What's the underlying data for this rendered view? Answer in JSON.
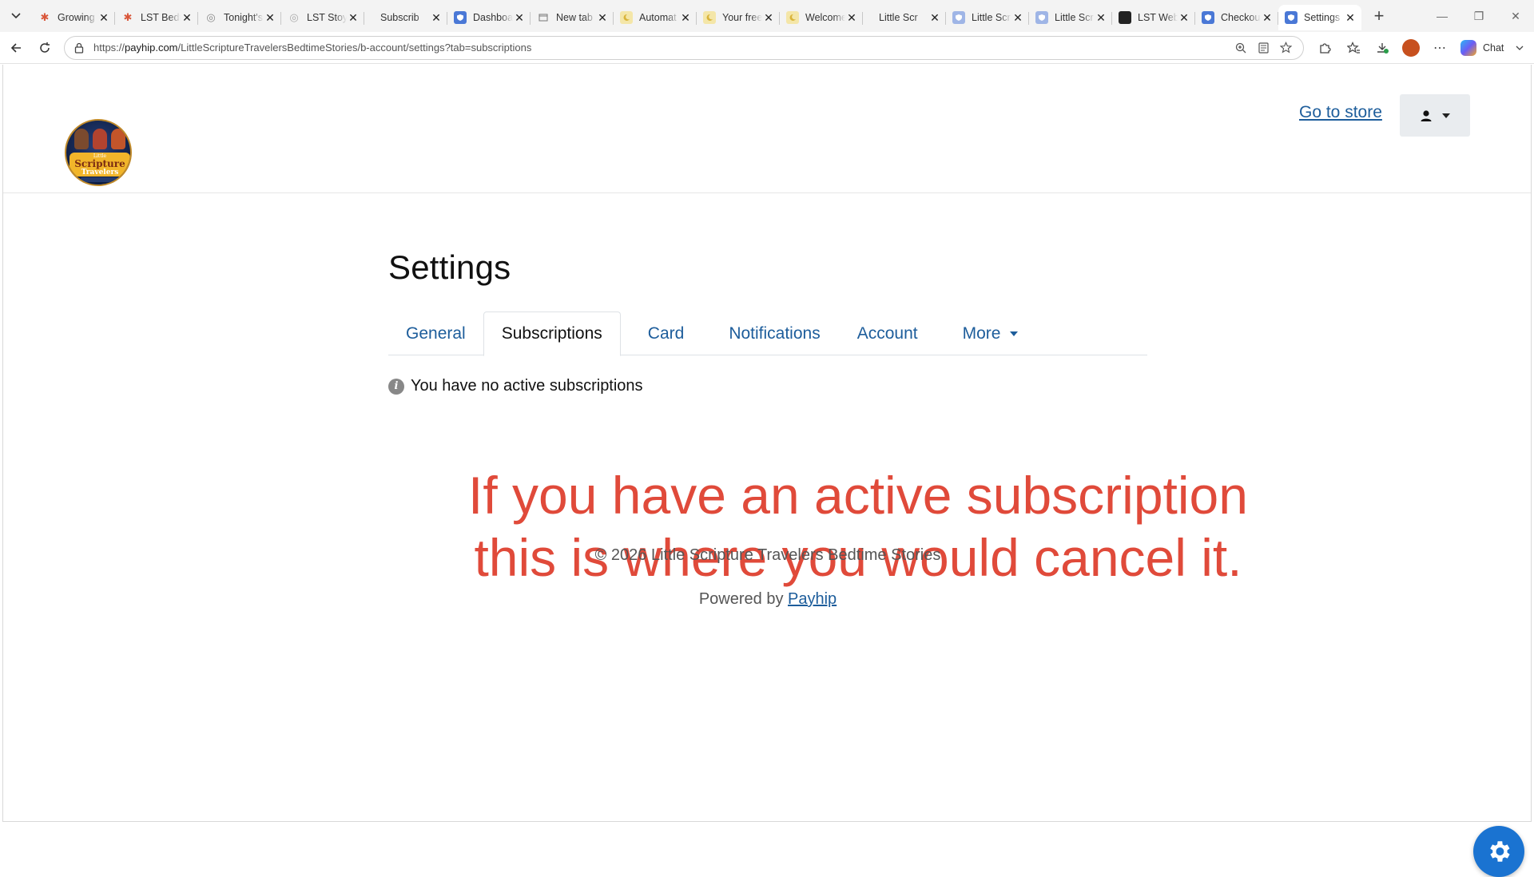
{
  "browser": {
    "tabs": [
      {
        "title": "Growing",
        "icon": "asterisk-icon",
        "color": "#d9573a"
      },
      {
        "title": "LST Bedt",
        "icon": "asterisk-icon",
        "color": "#d9573a"
      },
      {
        "title": "Tonight's",
        "icon": "globe-icon",
        "color": "#888888"
      },
      {
        "title": "LST Stoy",
        "icon": "globe-icon",
        "color": "#aaaaaa"
      },
      {
        "title": "Subscrib",
        "icon": "blank-icon",
        "color": "#ffffff"
      },
      {
        "title": "Dashboa",
        "icon": "shield-icon",
        "color": "#4a78d6"
      },
      {
        "title": "New tab",
        "icon": "newtab-icon",
        "color": "#777777"
      },
      {
        "title": "Automat",
        "icon": "moon-icon",
        "color": "#d9b43a"
      },
      {
        "title": "Your free",
        "icon": "moon-icon",
        "color": "#d9b43a"
      },
      {
        "title": "Welcome",
        "icon": "moon-icon",
        "color": "#d9b43a"
      },
      {
        "title": "Little Scr",
        "icon": "blank-icon",
        "color": "#ffffff"
      },
      {
        "title": "Little Scr",
        "icon": "shield-icon",
        "color": "#9fb5e6"
      },
      {
        "title": "Little Scr",
        "icon": "shield-icon",
        "color": "#9fb5e6"
      },
      {
        "title": "LST Web",
        "icon": "dark-square-icon",
        "color": "#222222"
      },
      {
        "title": "Checkout",
        "icon": "shield-icon",
        "color": "#4a78d6"
      },
      {
        "title": "Settings",
        "icon": "shield-icon",
        "color": "#4a78d6",
        "active": true
      }
    ],
    "url_prefix": "https://",
    "url_domain": "payhip.com",
    "url_path": "/LittleScriptureTravelersBedtimeStories/b-account/settings?tab=subscriptions",
    "chat_label": "Chat"
  },
  "header": {
    "logo_line1": "Little",
    "logo_line2": "Scripture",
    "logo_line3": "Travelers",
    "go_to_store": "Go to store"
  },
  "settings": {
    "title": "Settings",
    "tabs": [
      "General",
      "Subscriptions",
      "Card",
      "Notifications",
      "Account",
      "More"
    ],
    "active_tab": "Subscriptions",
    "notice": "You have no active subscriptions"
  },
  "overlay": {
    "line1": "If you have an active subscription",
    "line2": "this is where you would cancel it."
  },
  "footer": {
    "copyright": "© 2026 Little Scripture Travelers Bedtime Stories",
    "powered_by": "Powered by",
    "payhip_link": "Payhip"
  },
  "colors": {
    "link": "#1d5d9b",
    "overlay_text": "#e04a3a",
    "fab": "#1a73d1"
  }
}
